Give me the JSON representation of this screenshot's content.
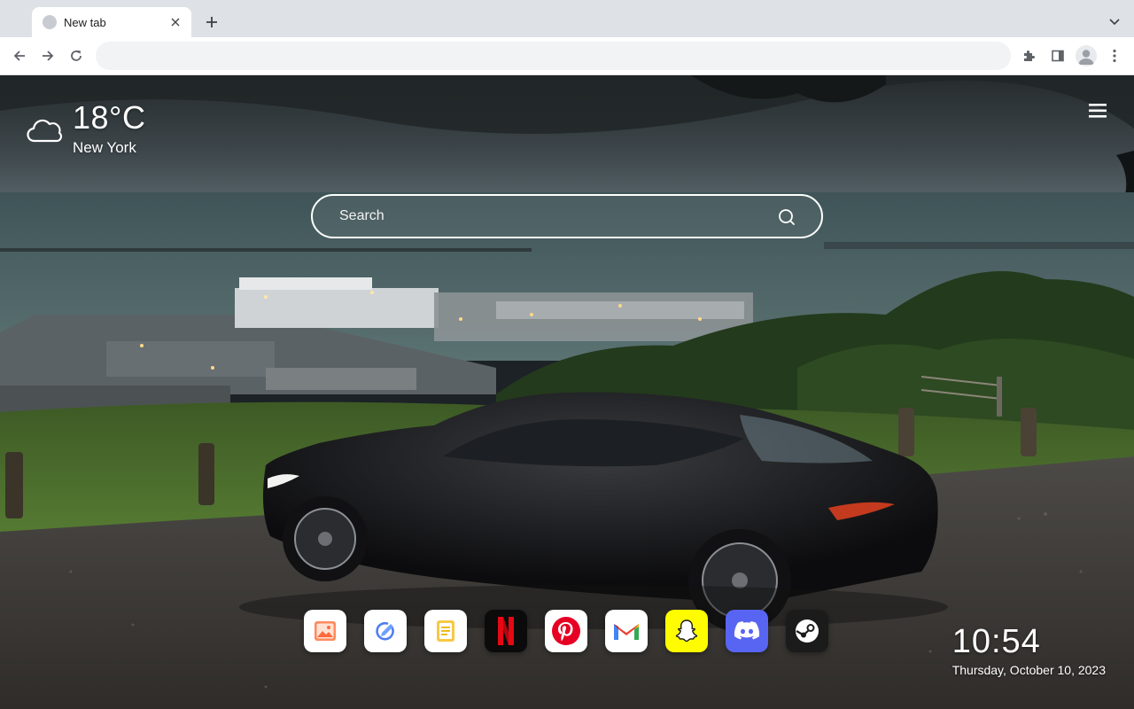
{
  "browser": {
    "tab": {
      "title": "New tab"
    },
    "omnibox": {
      "value": "",
      "placeholder": ""
    }
  },
  "weather": {
    "temperature": "18°C",
    "city": "New York",
    "icon": "cloud-icon"
  },
  "search": {
    "placeholder": "Search"
  },
  "shortcuts": [
    {
      "name": "gallery",
      "icon": "image-icon",
      "color": "#ffffff"
    },
    {
      "name": "tasks",
      "icon": "edit-check-icon",
      "color": "#ffffff"
    },
    {
      "name": "notes",
      "icon": "notes-icon",
      "color": "#ffffff"
    },
    {
      "name": "netflix",
      "icon": "netflix-icon",
      "color": "#0b0b0b"
    },
    {
      "name": "pinterest",
      "icon": "pinterest-icon",
      "color": "#ffffff"
    },
    {
      "name": "gmail",
      "icon": "gmail-icon",
      "color": "#ffffff"
    },
    {
      "name": "snapchat",
      "icon": "snapchat-icon",
      "color": "#fffc00"
    },
    {
      "name": "discord",
      "icon": "discord-icon",
      "color": "#5865f2"
    },
    {
      "name": "steam",
      "icon": "steam-icon",
      "color": "#1b1b1b"
    }
  ],
  "clock": {
    "time": "10:54",
    "date": "Thursday, October 10, 2023"
  }
}
